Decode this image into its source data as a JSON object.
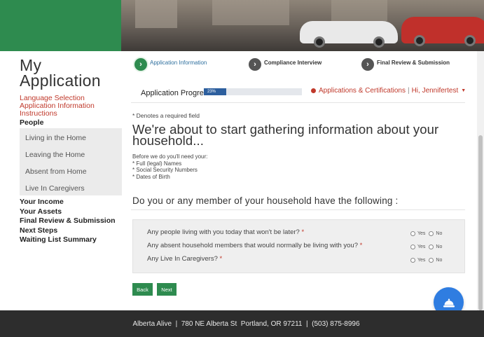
{
  "banner": {
    "brand_color": "#2e8b4f"
  },
  "sidebar": {
    "title": "My Application",
    "red_links": [
      "Language Selection",
      "Application Information",
      "Instructions"
    ],
    "people_label": "People",
    "sub_items": [
      "Living in the Home",
      "Leaving the Home",
      "Absent from Home",
      "Live In Caregivers"
    ],
    "bold_items": [
      "Your Income",
      "Your Assets",
      "Final Review & Submission",
      "Next Steps",
      "Waiting List Summary"
    ]
  },
  "steps": [
    {
      "label": "Application Information",
      "icon": "chevron-right-icon",
      "active": true
    },
    {
      "label": "Compliance Interview",
      "icon": "chevron-right-icon",
      "active": false
    },
    {
      "label": "Final Review & Submission",
      "icon": "chevron-right-icon",
      "active": false
    }
  ],
  "progress": {
    "label": "Application Progress",
    "percent_text": "23%",
    "value": 0.23
  },
  "nav": {
    "apps_link": "Applications & Certifications",
    "user": "Hi, Jennifertest",
    "caret": "▼"
  },
  "form": {
    "required_note": "* Denotes a required field",
    "heading": "We're about to start gathering information about your household...",
    "need_intro": "Before we do you'll need your:",
    "need_items": [
      "* Full (legal) Names",
      "* Social Security Numbers",
      "* Dates of Birth"
    ],
    "sub_heading": "Do you or any member of your household have the following :",
    "questions": [
      {
        "text": "Any people living with you today that won't be later?",
        "required": "*"
      },
      {
        "text": "Any absent household members that would normally be living with you?",
        "required": "*"
      },
      {
        "text": "Any Live In Caregivers?",
        "required": "*"
      }
    ],
    "yes_label": "Yes",
    "no_label": "No"
  },
  "buttons": {
    "back": "Back",
    "next": "Next"
  },
  "chat": {
    "icon": "concierge-bell-icon",
    "color": "#2f7de1"
  },
  "footer": {
    "text": "Alberta Alive  |  780 NE Alberta St  Portland, OR 97211  |  (503) 875-8996"
  }
}
